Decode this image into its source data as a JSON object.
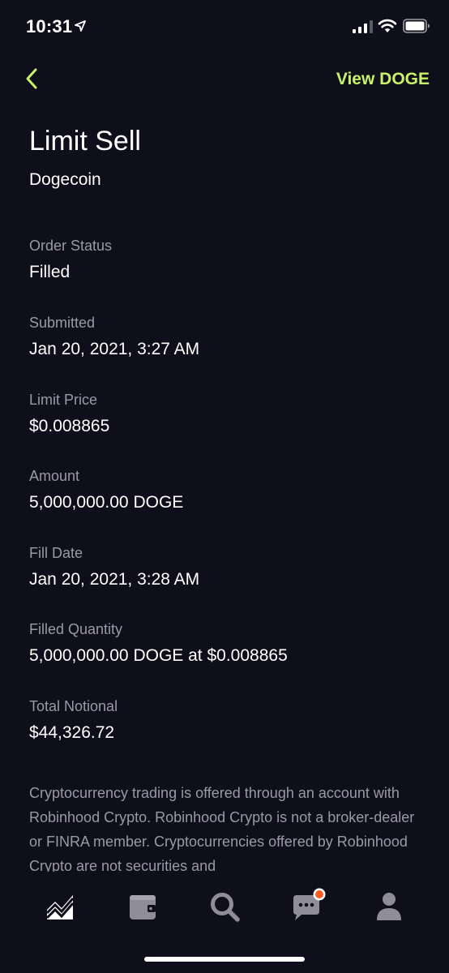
{
  "status_bar": {
    "time": "10:31"
  },
  "header": {
    "view_link": "View DOGE"
  },
  "order": {
    "title": "Limit Sell",
    "asset": "Dogecoin"
  },
  "fields": [
    {
      "label": "Order Status",
      "value": "Filled"
    },
    {
      "label": "Submitted",
      "value": "Jan 20, 2021, 3:27 AM"
    },
    {
      "label": "Limit Price",
      "value": "$0.008865"
    },
    {
      "label": "Amount",
      "value": "5,000,000.00 DOGE"
    },
    {
      "label": "Fill Date",
      "value": "Jan 20, 2021, 3:28 AM"
    },
    {
      "label": "Filled Quantity",
      "value": "5,000,000.00 DOGE at $0.008865"
    },
    {
      "label": "Total Notional",
      "value": "$44,326.72"
    }
  ],
  "disclaimer": "Cryptocurrency trading is offered through an account with Robinhood Crypto. Robinhood Crypto is not a broker-dealer or FINRA member. Cryptocurrencies offered by Robinhood Crypto are not securities and",
  "tab_bar": {
    "tabs": [
      {
        "icon": "chart-icon",
        "active": true
      },
      {
        "icon": "wallet-icon",
        "active": false
      },
      {
        "icon": "search-icon",
        "active": false
      },
      {
        "icon": "messages-icon",
        "active": false,
        "notification": true
      },
      {
        "icon": "profile-icon",
        "active": false
      }
    ]
  },
  "colors": {
    "background": "#0f0e1b",
    "accent": "#c8f269",
    "muted": "#9a99a6",
    "inactive_icon": "#8e8d99",
    "notification": "#ff5a1f"
  }
}
